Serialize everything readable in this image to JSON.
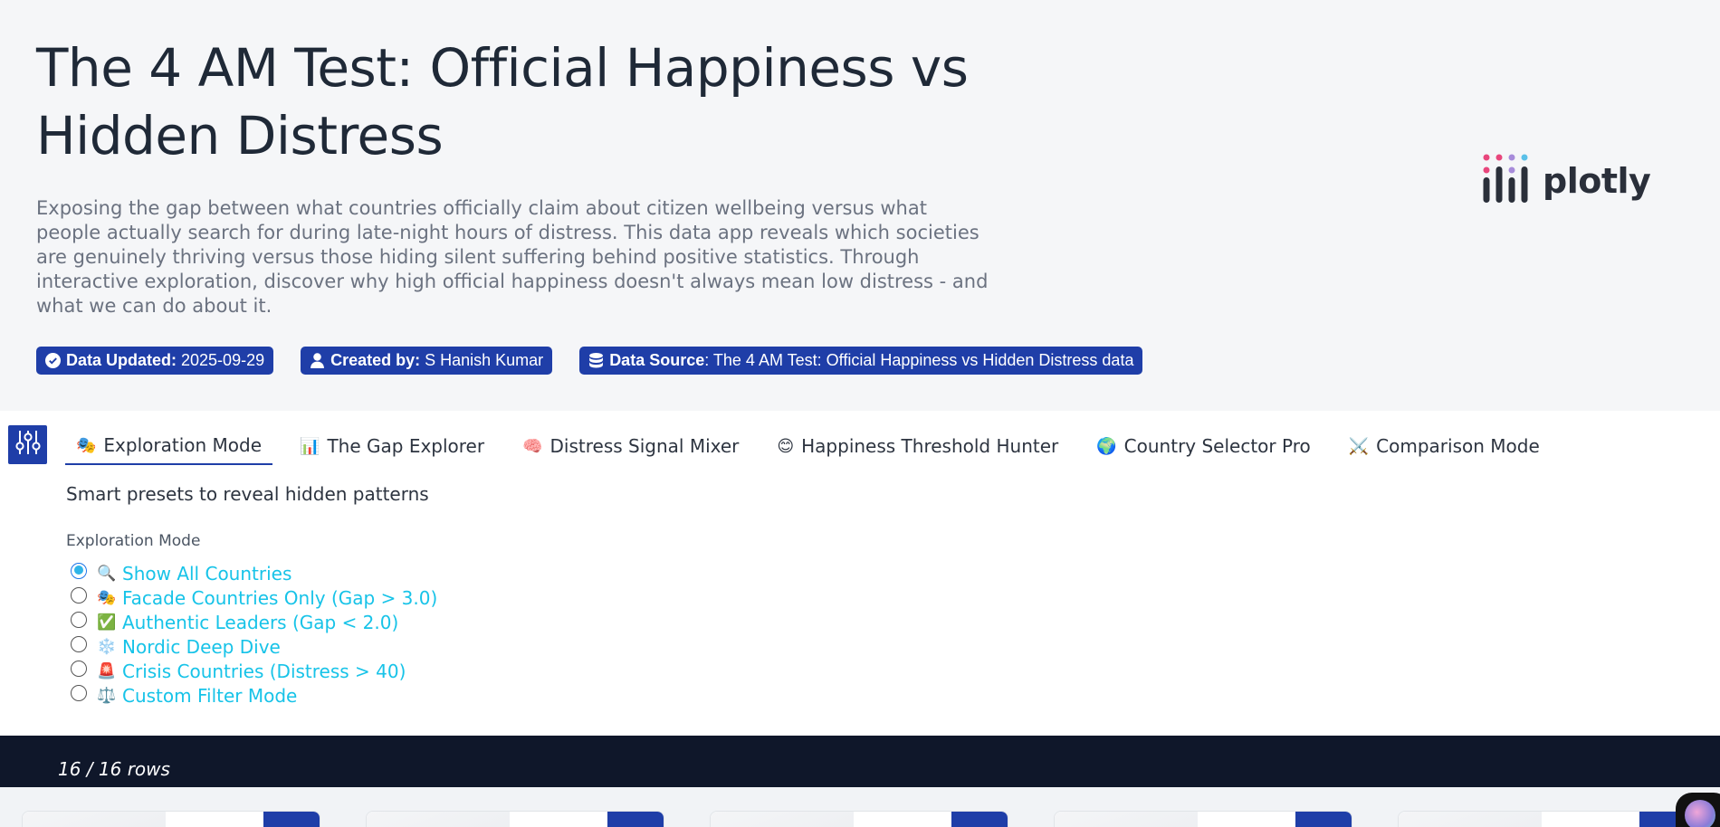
{
  "header": {
    "title": "The 4 AM Test: Official Happiness vs Hidden Distress",
    "description": "Exposing the gap between what countries officially claim about citizen wellbeing versus what people actually search for during late-night hours of distress. This data app reveals which societies are genuinely thriving versus those hiding silent suffering behind positive statistics. Through interactive exploration, discover why high official happiness doesn't always mean low distress - and what we can do about it.",
    "badges": [
      {
        "icon": "check-circle-icon",
        "label": "Data Updated:",
        "value": "2025-09-29"
      },
      {
        "icon": "user-icon",
        "label": "Created by:",
        "value": "S Hanish Kumar"
      },
      {
        "icon": "database-icon",
        "label": "Data Source",
        "value": ": The 4 AM Test: Official Happiness vs Hidden Distress data"
      }
    ],
    "logo_text": "plotly"
  },
  "tabs": [
    {
      "icon": "🎭",
      "label": "Exploration Mode",
      "active": true
    },
    {
      "icon": "📊",
      "label": "The Gap Explorer"
    },
    {
      "icon": "🧠",
      "label": "Distress Signal Mixer"
    },
    {
      "icon": "😊",
      "label": "Happiness Threshold Hunter"
    },
    {
      "icon": "🌍",
      "label": "Country Selector Pro"
    },
    {
      "icon": "⚔️",
      "label": "Comparison Mode"
    }
  ],
  "panel": {
    "subtitle": "Smart presets to reveal hidden patterns",
    "radio_group_label": "Exploration Mode",
    "options": [
      {
        "icon": "🔍",
        "label": "Show All Countries",
        "checked": true
      },
      {
        "icon": "🎭",
        "label": "Facade Countries Only (Gap > 3.0)"
      },
      {
        "icon": "✅",
        "label": "Authentic Leaders (Gap < 2.0)"
      },
      {
        "icon": "❄️",
        "label": "Nordic Deep Dive"
      },
      {
        "icon": "🚨",
        "label": "Crisis Countries (Distress > 40)"
      },
      {
        "icon": "⚖️",
        "label": "Custom Filter Mode"
      }
    ]
  },
  "status": {
    "rows_count": "16 / 16 rows"
  },
  "colors": {
    "accent": "#1f3ea8",
    "link": "#17c3e8",
    "dark_bar": "#0f172a"
  }
}
